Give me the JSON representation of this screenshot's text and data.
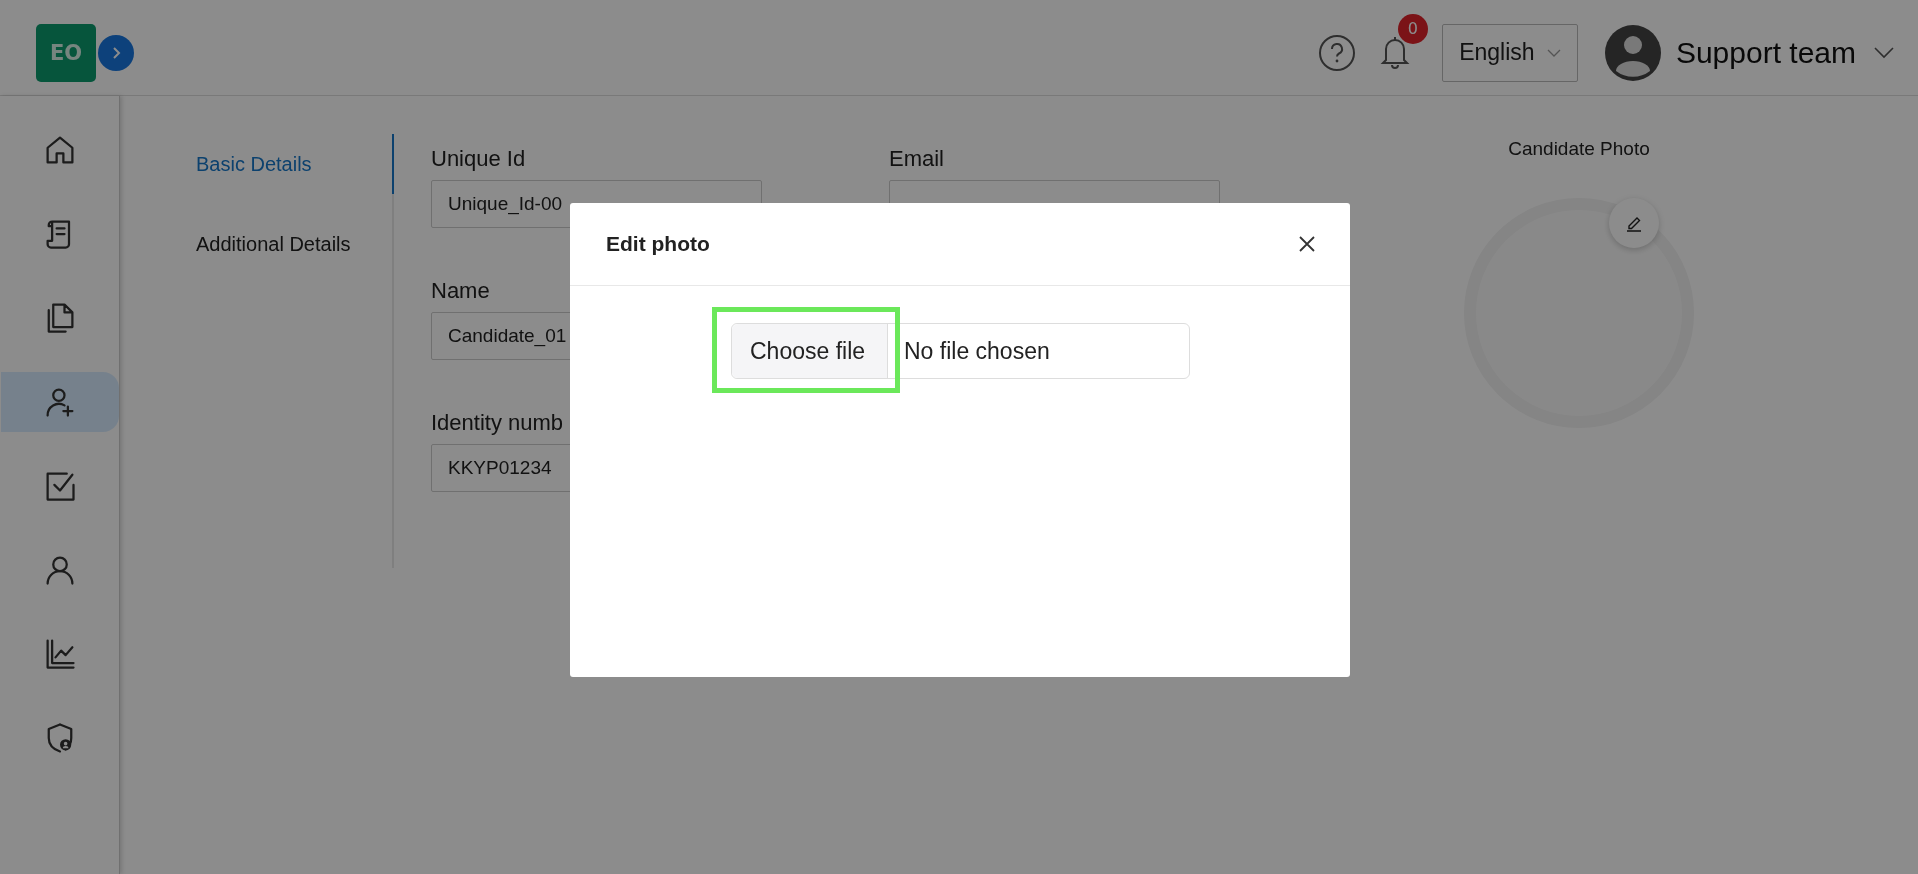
{
  "header": {
    "logo": "EO",
    "notifications": "0",
    "language": "English",
    "user": "Support team"
  },
  "sidebar": {
    "items": [
      {
        "kind": "home",
        "selected": false
      },
      {
        "kind": "scroll",
        "selected": false
      },
      {
        "kind": "documents",
        "selected": false
      },
      {
        "kind": "add-user",
        "selected": true
      },
      {
        "kind": "checkbox",
        "selected": false
      },
      {
        "kind": "user",
        "selected": false
      },
      {
        "kind": "chart",
        "selected": false
      },
      {
        "kind": "shield",
        "selected": false
      }
    ]
  },
  "tabs": [
    {
      "label": "Basic Details",
      "selected": true
    },
    {
      "label": "Additional Details",
      "selected": false
    }
  ],
  "form": {
    "columns": [
      {
        "fields": [
          {
            "label": "Unique Id",
            "value": "Unique_Id-00"
          },
          {
            "label": "Name",
            "value": "Candidate_01"
          },
          {
            "label": "Identity numb",
            "value": "KKYP01234"
          }
        ]
      },
      {
        "fields": [
          {
            "label": "Email"
          }
        ]
      }
    ]
  },
  "photo": {
    "label": "Candidate Photo"
  },
  "modal": {
    "title": "Edit photo",
    "file_input": {
      "button": "Choose file",
      "value": "No file chosen",
      "highlighted": true
    }
  }
}
